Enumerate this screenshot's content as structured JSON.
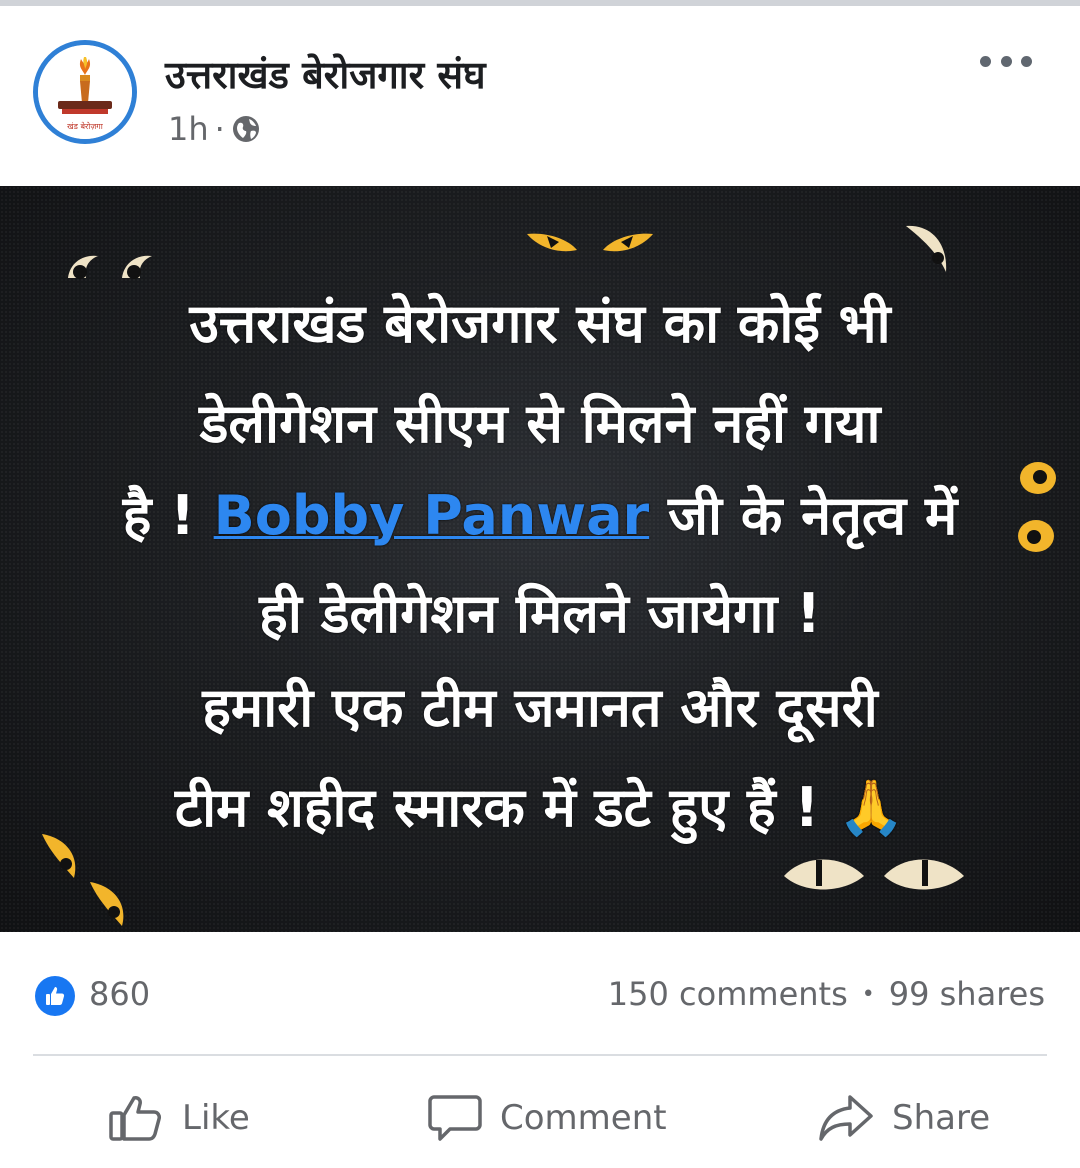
{
  "post": {
    "page_name": "उत्तराखंड बेरोजगार संघ",
    "time": "1h",
    "separator": "·",
    "audience_icon": "globe-icon",
    "avatar_caption": "खंड बेरोज़गा"
  },
  "image_text": {
    "line1": "उत्तराखंड बेरोजगार संघ का कोई भी",
    "line2": "डेलीगेशन सीएम से मिलने नहीं गया",
    "line3_prefix": "है ! ",
    "line3_mention": "Bobby Panwar",
    "line3_suffix": " जी के नेतृत्व में",
    "line4": "ही डेलीगेशन मिलने जायेगा !",
    "line5": "हमारी एक टीम जमानत और दूसरी",
    "line6_text": "टीम शहीद स्मारक में डटे हुए हैं ! ",
    "line6_emoji": "🙏"
  },
  "reactions": {
    "count": "860",
    "comments": "150 comments",
    "dot": "•",
    "shares": "99 shares"
  },
  "actions": {
    "like": "Like",
    "comment": "Comment",
    "share": "Share"
  },
  "colors": {
    "accent": "#1877f2",
    "mention": "#2d87f0",
    "eye": "#f2b52b"
  }
}
